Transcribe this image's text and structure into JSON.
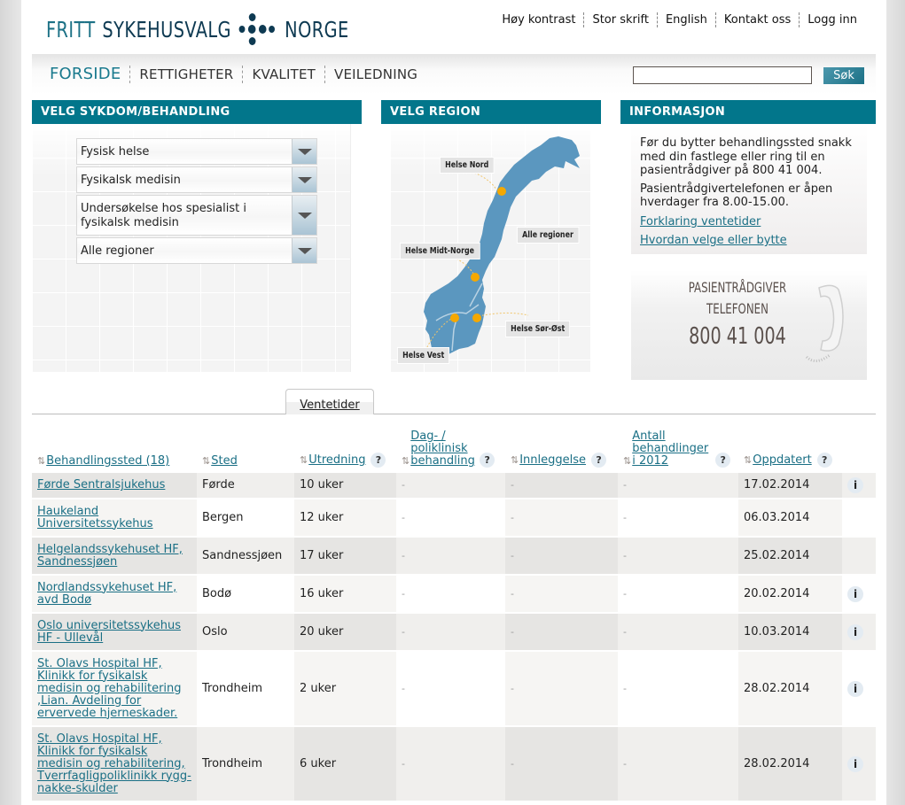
{
  "header": {
    "logo": {
      "part1": "FRITT",
      "part2": "SYKEHUSVALG",
      "part3": "NORGE"
    },
    "util_nav": [
      "Høy kontrast",
      "Stor skrift",
      "English",
      "Kontakt oss",
      "Logg inn"
    ],
    "main_nav": [
      "FORSIDE",
      "RETTIGHETER",
      "KVALITET",
      "VEILEDNING"
    ],
    "search": {
      "value": "",
      "placeholder": "",
      "button": "Søk"
    }
  },
  "colors": {
    "accent": "#02768b",
    "link": "#1a6f85",
    "map": "#5b97bf",
    "map_dot": "#f5a800"
  },
  "panel_treatment": {
    "title": "VELG SYKDOM/BEHANDLING",
    "selects": [
      "Fysisk helse",
      "Fysikalsk medisin",
      "Undersøkelse hos spesialist i fysikalsk medisin",
      "Alle regioner"
    ]
  },
  "panel_region": {
    "title": "VELG REGION",
    "labels": {
      "nord": "Helse Nord",
      "alle": "Alle regioner",
      "midt": "Helse Midt-Norge",
      "sorost": "Helse Sør-Øst",
      "vest": "Helse Vest"
    }
  },
  "panel_info": {
    "title": "INFORMASJON",
    "text1": "Før du bytter behandlingssted snakk med din fastlege eller ring til en pasientrådgiver på 800 41 004.",
    "text2": "Pasientrådgivertelefonen er åpen hverdager fra 8.00-15.00.",
    "link1": "Forklaring ventetider",
    "link2": "Hvordan velge eller bytte",
    "phone_banner": {
      "line1": "PASIENTRÅDGIVER",
      "line2": "TELEFONEN",
      "number": "800 41 004"
    }
  },
  "tabs": [
    {
      "label": "Ventetider",
      "active": true
    }
  ],
  "table": {
    "headers": [
      {
        "label": "Behandlingssted (18)",
        "help": false
      },
      {
        "label": "Sted",
        "help": false
      },
      {
        "label": "Utredning",
        "help": true
      },
      {
        "label": "Dag- / poliklinisk behandling",
        "help": true
      },
      {
        "label": "Innleggelse",
        "help": true
      },
      {
        "label": "Antall behandlinger i 2012",
        "help": true
      },
      {
        "label": "Oppdatert",
        "help": true
      }
    ],
    "sort_icon": "⇅",
    "help_icon": "?",
    "info_icon": "i",
    "rows": [
      {
        "name": "Førde Sentralsjukehus",
        "sted": "Førde",
        "utredning": "10 uker",
        "dag": "-",
        "innleggelse": "-",
        "antall": "-",
        "oppdatert": "17.02.2014",
        "info": true
      },
      {
        "name": "Haukeland Universitetssykehus",
        "sted": "Bergen",
        "utredning": "12 uker",
        "dag": "-",
        "innleggelse": "-",
        "antall": "-",
        "oppdatert": "06.03.2014",
        "info": false
      },
      {
        "name": "Helgelandssykehuset HF, Sandnessjøen",
        "sted": "Sandnessjøen",
        "utredning": "17 uker",
        "dag": "-",
        "innleggelse": "-",
        "antall": "-",
        "oppdatert": "25.02.2014",
        "info": false
      },
      {
        "name": "Nordlandssykehuset HF, avd Bodø",
        "sted": "Bodø",
        "utredning": "16 uker",
        "dag": "-",
        "innleggelse": "-",
        "antall": "-",
        "oppdatert": "20.02.2014",
        "info": true
      },
      {
        "name": "Oslo universitetssykehus HF - Ullevål",
        "sted": "Oslo",
        "utredning": "20 uker",
        "dag": "-",
        "innleggelse": "-",
        "antall": "-",
        "oppdatert": "10.03.2014",
        "info": true
      },
      {
        "name": "St. Olavs Hospital HF, Klinikk for fysikalsk medisin og rehabilitering ,Lian. Avdeling for ervervede hjerneskader.",
        "sted": "Trondheim",
        "utredning": "2 uker",
        "dag": "-",
        "innleggelse": "-",
        "antall": "-",
        "oppdatert": "28.02.2014",
        "info": true
      },
      {
        "name": "St. Olavs Hospital HF, Klinikk for fysikalsk medisin og rehabilitering, Tverrfagligpoliklinikk rygg-nakke-skulder",
        "sted": "Trondheim",
        "utredning": "6 uker",
        "dag": "-",
        "innleggelse": "-",
        "antall": "-",
        "oppdatert": "28.02.2014",
        "info": true
      }
    ]
  }
}
